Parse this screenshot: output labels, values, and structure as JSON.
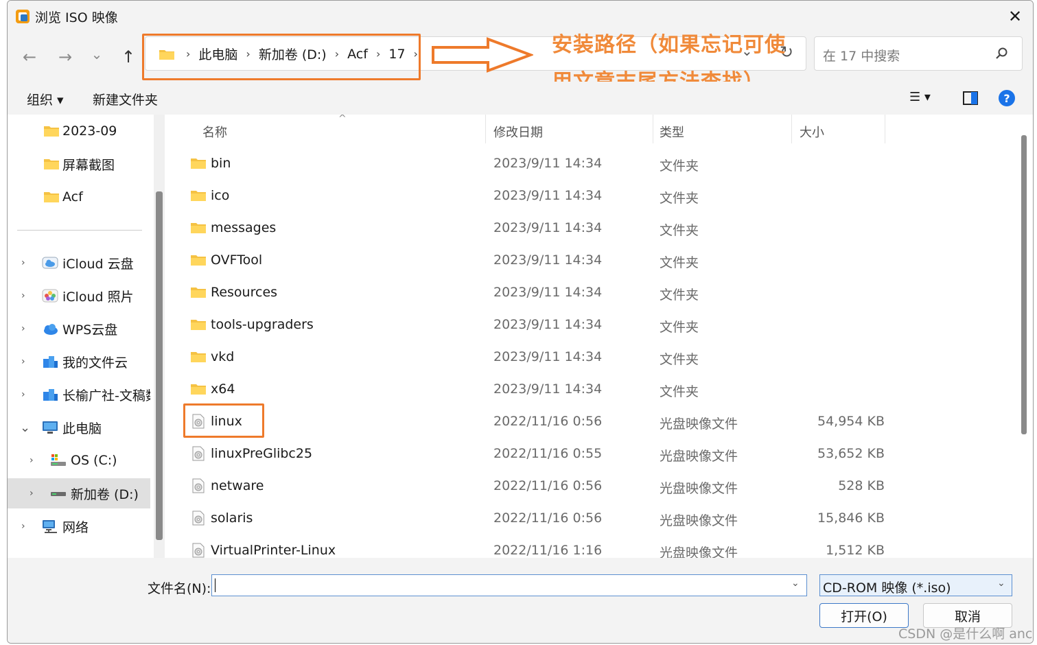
{
  "window": {
    "title": "浏览 ISO 映像",
    "close_glyph": "✕"
  },
  "nav": {
    "back_glyph": "←",
    "forward_glyph": "→",
    "recent_glyph": "⌄",
    "up_glyph": "↑",
    "breadcrumbs": [
      "此电脑",
      "新加卷 (D:)",
      "Acf",
      "17"
    ],
    "crumb_sep": "›",
    "address_dropdown_glyph": "⌄",
    "refresh_glyph": "↻",
    "search_placeholder": "在 17 中搜索"
  },
  "annotation": {
    "line1": "安装路径（如果忘记可使",
    "line2": "用文章末尾方法查找）",
    "color": "#f08a3a"
  },
  "toolbar": {
    "organize": "组织 ▾",
    "new_folder": "新建文件夹",
    "view_glyph": "☰ ▾",
    "help_glyph": "?"
  },
  "sidebar": {
    "quick_items": [
      {
        "label": "2023-09",
        "icon": "folder-icon"
      },
      {
        "label": "屏幕截图",
        "icon": "folder-icon"
      },
      {
        "label": "Acf",
        "icon": "folder-icon"
      }
    ],
    "tree_items": [
      {
        "label": "iCloud 云盘",
        "icon": "icloud-drive-icon",
        "chev": "›"
      },
      {
        "label": "iCloud 照片",
        "icon": "icloud-photos-icon",
        "chev": "›"
      },
      {
        "label": "WPS云盘",
        "icon": "wps-cloud-icon",
        "chev": "›"
      },
      {
        "label": "我的文件云",
        "icon": "file-cloud-icon",
        "chev": "›"
      },
      {
        "label": "长榆广社-文稿数",
        "icon": "file-cloud-icon",
        "chev": "›"
      },
      {
        "label": "此电脑",
        "icon": "this-pc-icon",
        "chev": "⌄"
      },
      {
        "label": "OS (C:)",
        "icon": "os-drive-icon",
        "chev": "›"
      },
      {
        "label": "新加卷 (D:)",
        "icon": "drive-icon",
        "chev": "›"
      },
      {
        "label": "网络",
        "icon": "network-icon",
        "chev": "›"
      }
    ]
  },
  "columns": {
    "name": "名称",
    "date": "修改日期",
    "type": "类型",
    "size": "大小",
    "sort_glyph": "^"
  },
  "files": [
    {
      "name": "bin",
      "date": "2023/9/11 14:34",
      "type": "文件夹",
      "size": "",
      "icon": "folder-icon"
    },
    {
      "name": "ico",
      "date": "2023/9/11 14:34",
      "type": "文件夹",
      "size": "",
      "icon": "folder-icon"
    },
    {
      "name": "messages",
      "date": "2023/9/11 14:34",
      "type": "文件夹",
      "size": "",
      "icon": "folder-icon"
    },
    {
      "name": "OVFTool",
      "date": "2023/9/11 14:34",
      "type": "文件夹",
      "size": "",
      "icon": "folder-icon"
    },
    {
      "name": "Resources",
      "date": "2023/9/11 14:34",
      "type": "文件夹",
      "size": "",
      "icon": "folder-icon"
    },
    {
      "name": "tools-upgraders",
      "date": "2023/9/11 14:34",
      "type": "文件夹",
      "size": "",
      "icon": "folder-icon"
    },
    {
      "name": "vkd",
      "date": "2023/9/11 14:34",
      "type": "文件夹",
      "size": "",
      "icon": "folder-icon"
    },
    {
      "name": "x64",
      "date": "2023/9/11 14:34",
      "type": "文件夹",
      "size": "",
      "icon": "folder-icon"
    },
    {
      "name": "linux",
      "date": "2022/11/16 0:56",
      "type": "光盘映像文件",
      "size": "54,954 KB",
      "icon": "disc-image-icon"
    },
    {
      "name": "linuxPreGlibc25",
      "date": "2022/11/16 0:55",
      "type": "光盘映像文件",
      "size": "53,652 KB",
      "icon": "disc-image-icon"
    },
    {
      "name": "netware",
      "date": "2022/11/16 0:56",
      "type": "光盘映像文件",
      "size": "528 KB",
      "icon": "disc-image-icon"
    },
    {
      "name": "solaris",
      "date": "2022/11/16 0:56",
      "type": "光盘映像文件",
      "size": "15,846 KB",
      "icon": "disc-image-icon"
    },
    {
      "name": "VirtualPrinter-Linux",
      "date": "2022/11/16 1:16",
      "type": "光盘映像文件",
      "size": "1,512 KB",
      "icon": "disc-image-icon"
    }
  ],
  "bottom": {
    "filename_label": "文件名(N):",
    "filename_value": "",
    "filter_value": "CD-ROM 映像 (*.iso)",
    "dropdown_glyph": "⌄",
    "open_button": "打开(O)",
    "cancel_button": "取消"
  },
  "watermark": "CSDN @是什么啊 anc"
}
